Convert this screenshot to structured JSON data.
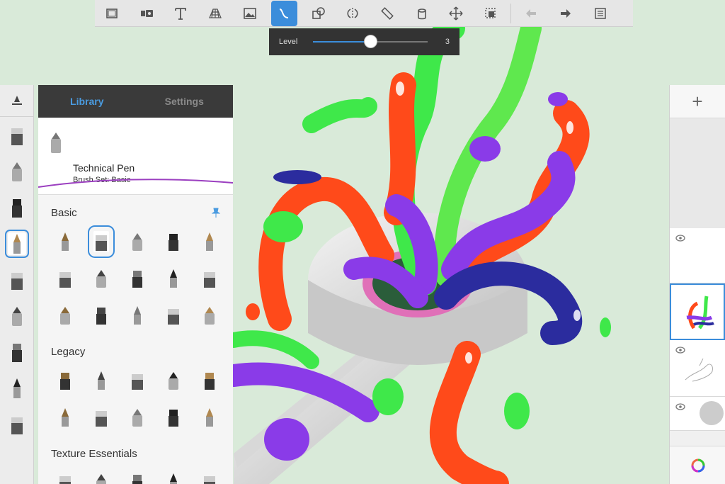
{
  "toolbar": {
    "tools": [
      {
        "id": "canvas",
        "icon": "canvas-icon",
        "label": "Canvas"
      },
      {
        "id": "import",
        "icon": "video-import-icon",
        "label": "Import"
      },
      {
        "id": "text",
        "icon": "text-icon",
        "label": "Text"
      },
      {
        "id": "perspective",
        "icon": "perspective-grid-icon",
        "label": "Perspective"
      },
      {
        "id": "image",
        "icon": "image-icon",
        "label": "Image"
      },
      {
        "id": "curve",
        "icon": "curve-icon",
        "label": "Curve",
        "active": true
      },
      {
        "id": "shapes",
        "icon": "shapes-icon",
        "label": "Shapes"
      },
      {
        "id": "symmetry",
        "icon": "symmetry-icon",
        "label": "Symmetry"
      },
      {
        "id": "ruler",
        "icon": "ruler-icon",
        "label": "Ruler"
      },
      {
        "id": "fill",
        "icon": "fill-bucket-icon",
        "label": "Fill"
      },
      {
        "id": "transform",
        "icon": "move-icon",
        "label": "Transform"
      },
      {
        "id": "selection",
        "icon": "selection-icon",
        "label": "Selection"
      },
      {
        "id": "undo",
        "icon": "undo-icon",
        "label": "Undo"
      },
      {
        "id": "redo",
        "icon": "redo-icon",
        "label": "Redo"
      },
      {
        "id": "menu",
        "icon": "list-icon",
        "label": "Menu"
      }
    ],
    "accent": "#3b8ddb"
  },
  "level_slider": {
    "label": "Level",
    "value": "3",
    "fraction": 0.5
  },
  "brush_panel": {
    "tabs": [
      "Library",
      "Settings"
    ],
    "active_tab": "Library",
    "current_brush": {
      "name": "Technical Pen",
      "set": "Brush Set: Basic"
    },
    "sections": [
      {
        "title": "Basic",
        "pinned": true,
        "brush_count": 15
      },
      {
        "title": "Legacy",
        "brush_count": 10
      },
      {
        "title": "Texture Essentials",
        "brush_count": 5
      }
    ]
  },
  "left_strip": {
    "brush_count": 9,
    "selected_index": 3
  },
  "layers": {
    "add_label": "+",
    "count": 4,
    "selected_index": 1
  }
}
